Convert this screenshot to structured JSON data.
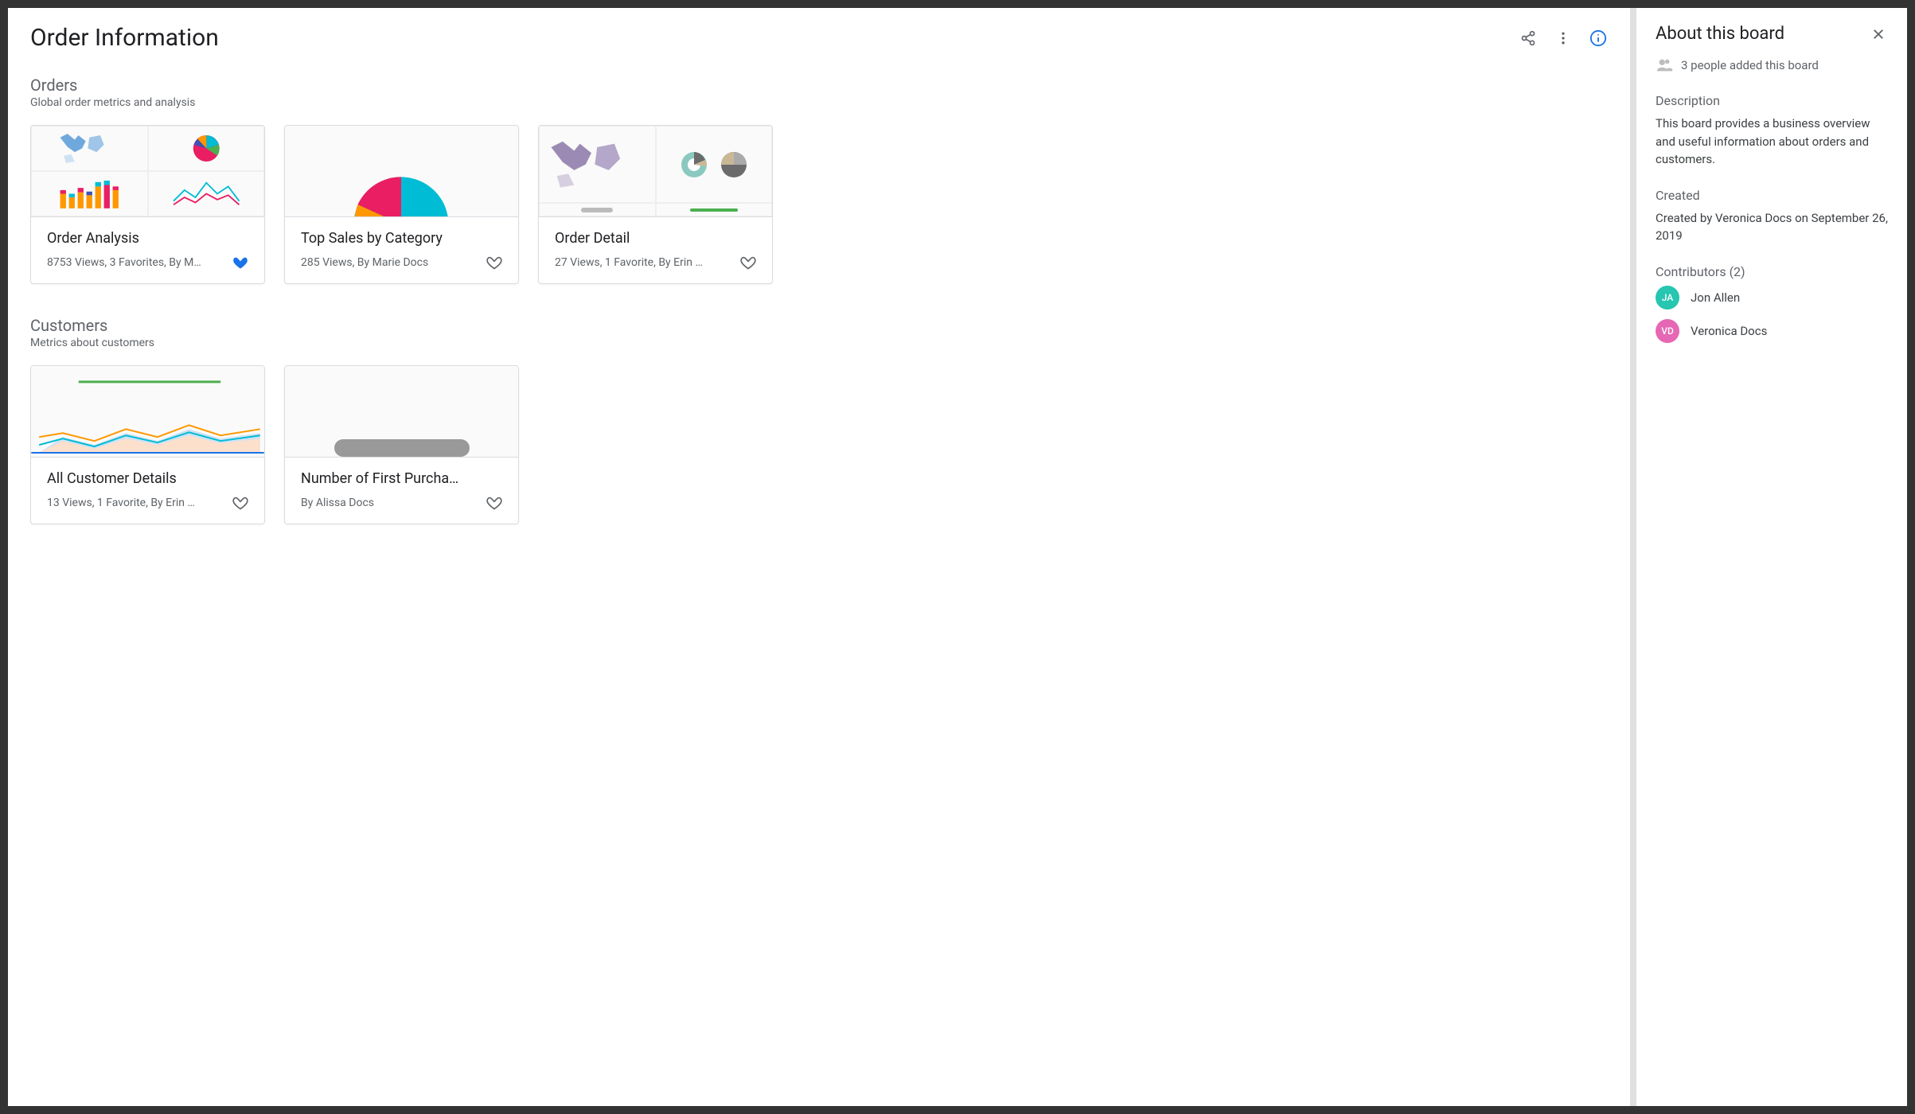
{
  "page": {
    "title": "Order Information"
  },
  "sections": [
    {
      "title": "Orders",
      "subtitle": "Global order metrics and analysis",
      "cards": [
        {
          "title": "Order Analysis",
          "meta": "8753 Views, 3 Favorites, By M…",
          "favorited": true
        },
        {
          "title": "Top Sales by Category",
          "meta": "285 Views, By Marie Docs",
          "favorited": false
        },
        {
          "title": "Order Detail",
          "meta": "27 Views, 1 Favorite, By Erin …",
          "favorited": false
        }
      ]
    },
    {
      "title": "Customers",
      "subtitle": "Metrics about customers",
      "cards": [
        {
          "title": "All Customer Details",
          "meta": "13 Views, 1 Favorite, By Erin …",
          "favorited": false
        },
        {
          "title": "Number of First Purcha…",
          "meta": "By Alissa Docs",
          "favorited": false
        }
      ]
    }
  ],
  "sidebar": {
    "title": "About this board",
    "people_text": "3 people added this board",
    "description_label": "Description",
    "description": "This board provides a business overview and useful information about orders and customers.",
    "created_label": "Created",
    "created": "Created by Veronica Docs on September 26, 2019",
    "contributors_label": "Contributors (2)",
    "contributors": [
      {
        "initials": "JA",
        "name": "Jon Allen",
        "color": "#26c6b0"
      },
      {
        "initials": "VD",
        "name": "Veronica Docs",
        "color": "#e667b3"
      }
    ]
  }
}
